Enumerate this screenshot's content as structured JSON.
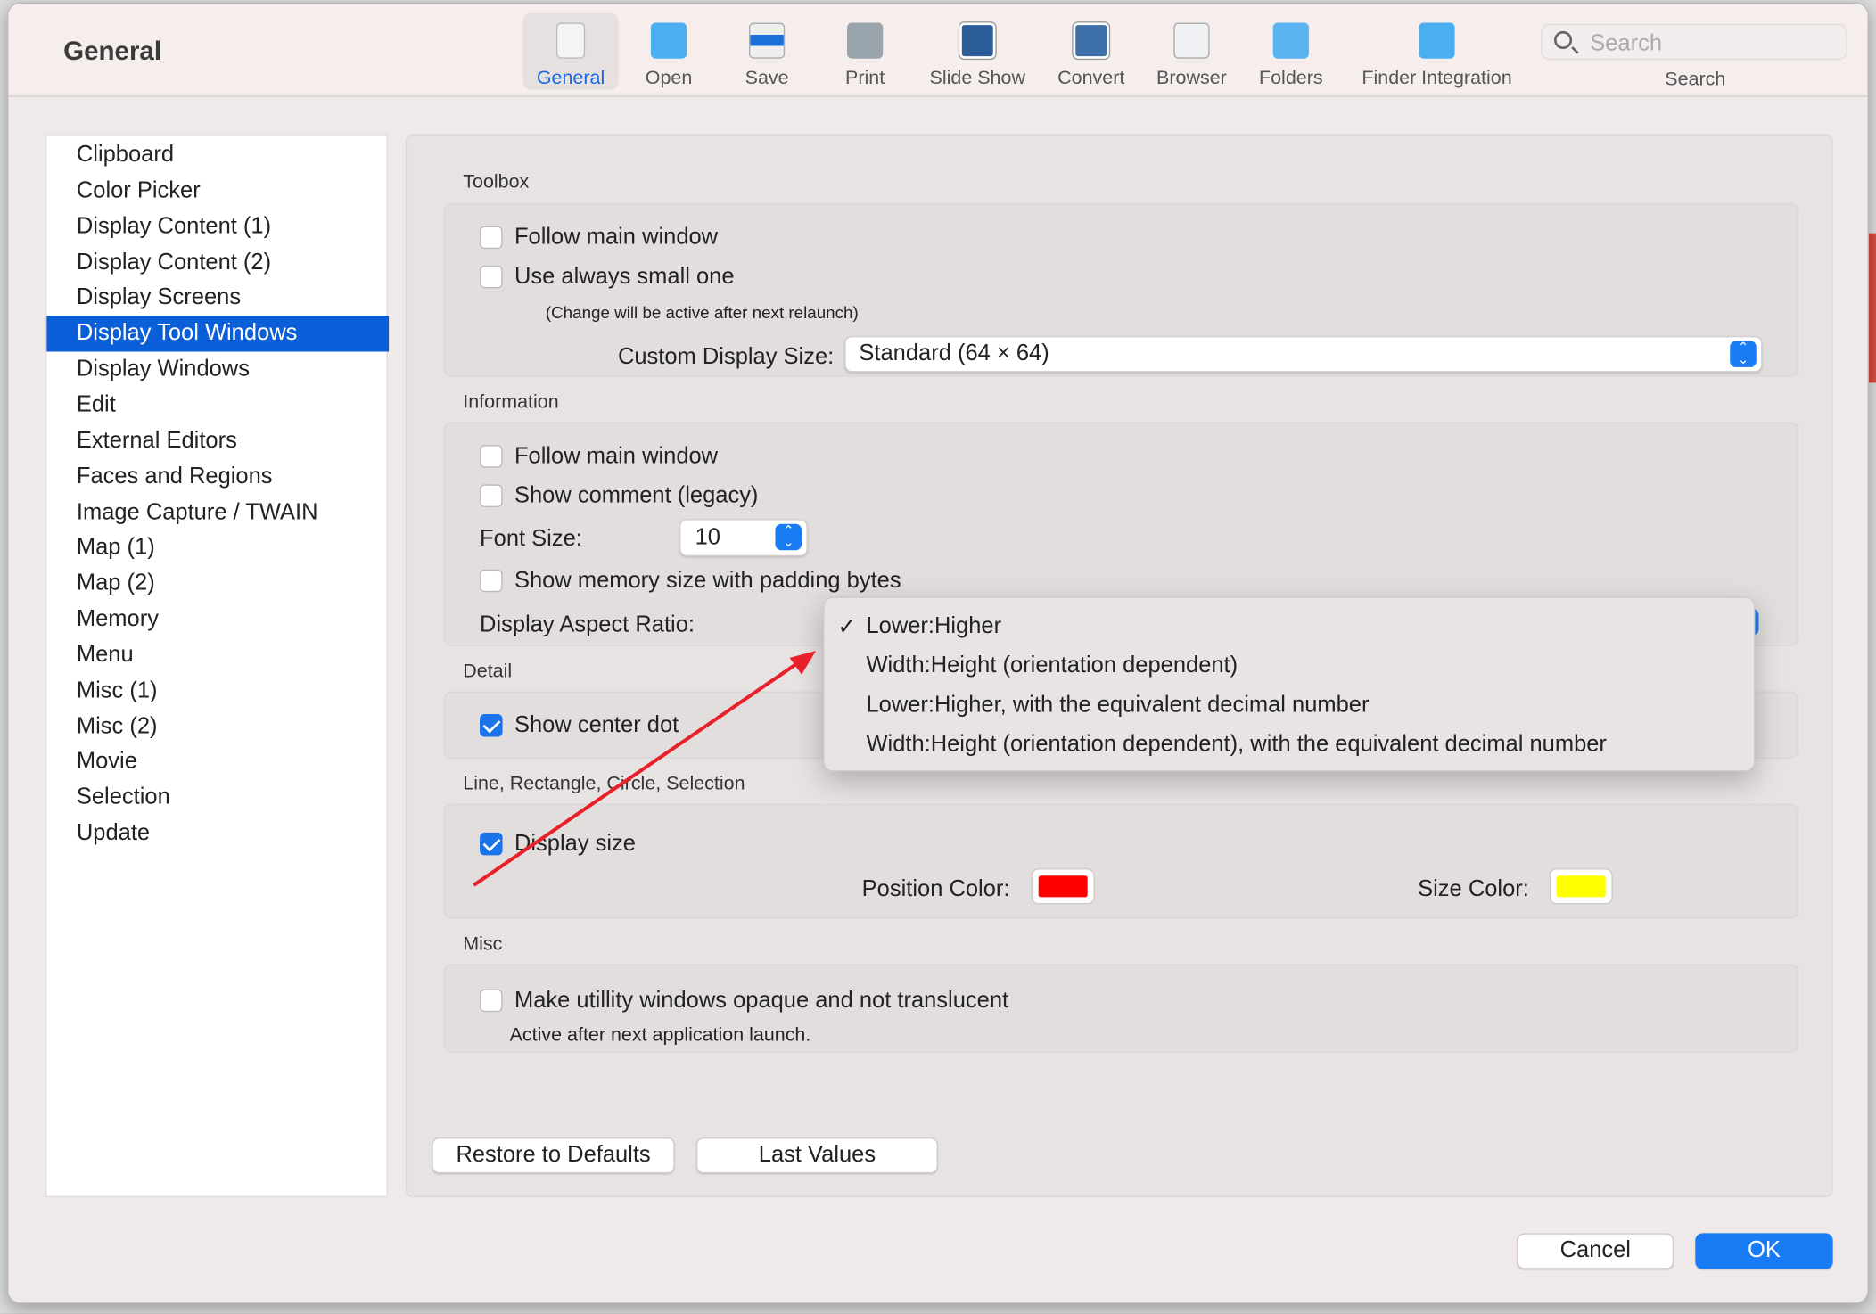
{
  "window_title": "General",
  "toolbar": {
    "items": [
      {
        "label": "General",
        "icon": "general-switch-icon",
        "selected": true
      },
      {
        "label": "Open",
        "icon": "folder-brush-icon"
      },
      {
        "label": "Save",
        "icon": "save-formats-icon"
      },
      {
        "label": "Print",
        "icon": "printer-icon"
      },
      {
        "label": "Slide Show",
        "icon": "slideshow-icon"
      },
      {
        "label": "Convert",
        "icon": "convert-icon"
      },
      {
        "label": "Browser",
        "icon": "browser-icon"
      },
      {
        "label": "Folders",
        "icon": "folders-icon"
      },
      {
        "label": "Finder Integration",
        "icon": "finder-integration-icon"
      }
    ],
    "search_placeholder": "Search",
    "search_label": "Search"
  },
  "sidebar": {
    "items": [
      "Clipboard",
      "Color Picker",
      "Display Content (1)",
      "Display Content (2)",
      "Display Screens",
      "Display Tool Windows",
      "Display Windows",
      "Edit",
      "External Editors",
      "Faces and Regions",
      "Image Capture / TWAIN",
      "Map (1)",
      "Map (2)",
      "Memory",
      "Menu",
      "Misc (1)",
      "Misc (2)",
      "Movie",
      "Selection",
      "Update"
    ],
    "selected": "Display Tool Windows"
  },
  "toolbox": {
    "title": "Toolbox",
    "follow_main": {
      "label": "Follow main window",
      "checked": false
    },
    "small_one": {
      "label": "Use always small one",
      "checked": false
    },
    "note": "(Change will be active after next relaunch)",
    "size_label": "Custom Display Size:",
    "size_value": "Standard (64 × 64)"
  },
  "information": {
    "title": "Information",
    "follow_main": {
      "label": "Follow main window",
      "checked": false
    },
    "show_comment": {
      "label": "Show comment (legacy)",
      "checked": false
    },
    "font_size_label": "Font Size:",
    "font_size_value": "10",
    "memory": {
      "label": "Show memory size with padding bytes",
      "checked": false
    },
    "aspect_label": "Display Aspect Ratio:"
  },
  "aspect_menu": {
    "options": [
      "Lower:Higher",
      "Width:Height (orientation dependent)",
      "Lower:Higher, with the equivalent decimal number",
      "Width:Height (orientation dependent), with the equivalent decimal number"
    ],
    "selected": "Lower:Higher",
    "check_mark": "✓"
  },
  "detail": {
    "title": "Detail",
    "center_dot": {
      "label": "Show center dot",
      "checked": true
    }
  },
  "line": {
    "title": "Line, Rectangle, Circle, Selection",
    "display_size": {
      "label": "Display size",
      "checked": true
    },
    "position_color_label": "Position Color:",
    "position_color": "#ff0000",
    "size_color_label": "Size Color:",
    "size_color": "#ffff00"
  },
  "misc": {
    "title": "Misc",
    "opaque": {
      "label": "Make utillity windows opaque and not translucent",
      "checked": false
    },
    "note": "Active after next application launch."
  },
  "buttons": {
    "restore": "Restore to Defaults",
    "last": "Last Values",
    "cancel": "Cancel",
    "ok": "OK"
  },
  "annotation_color": "#e8202a"
}
